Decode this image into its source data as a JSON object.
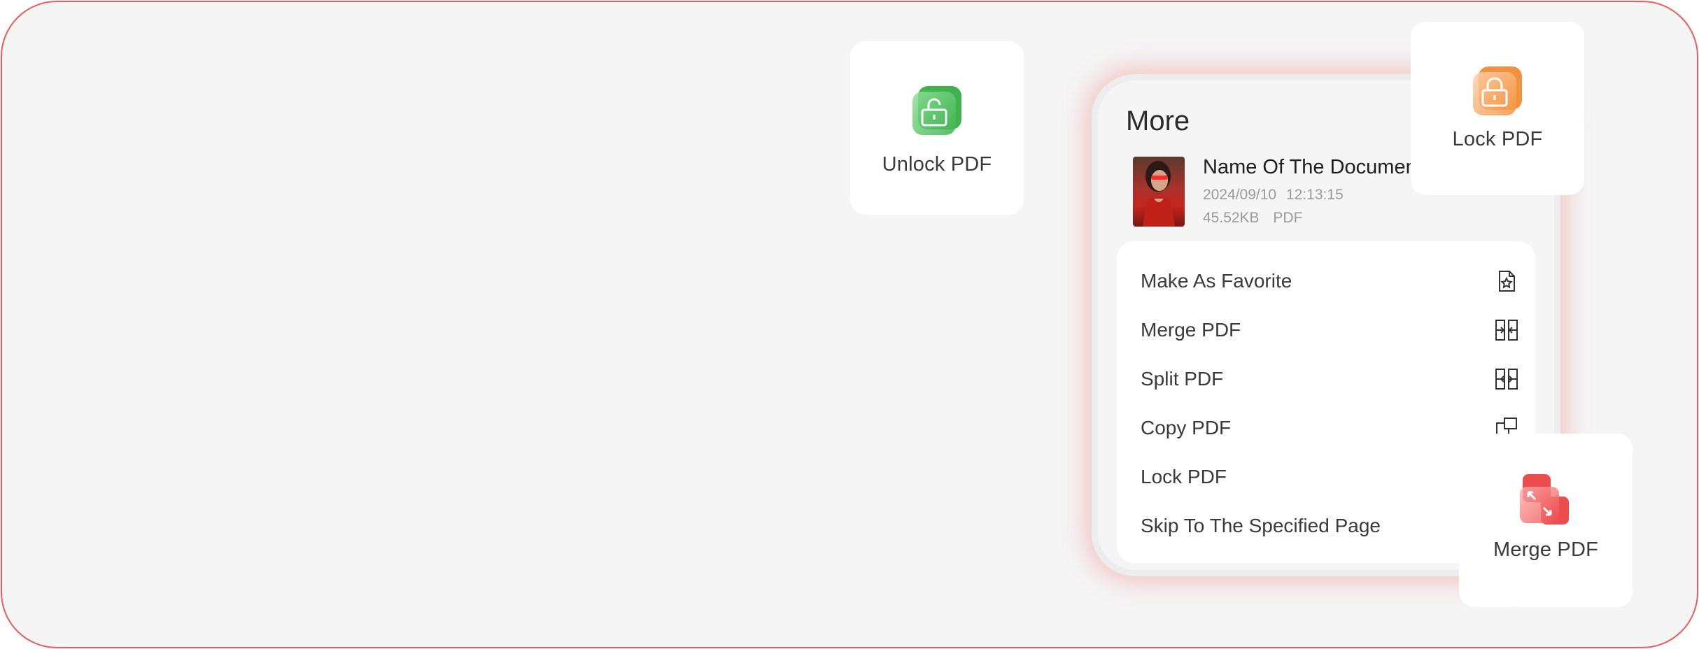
{
  "tiles": {
    "unlock": {
      "label": "Unlock PDF",
      "icon": "unlock-icon",
      "color": "#4cbf5c"
    },
    "lock": {
      "label": "Lock PDF",
      "icon": "lock-icon",
      "color": "#f59a4a"
    },
    "merge": {
      "label": "Merge PDF",
      "icon": "merge-icon",
      "color": "#ef5353"
    }
  },
  "panel": {
    "title": "More",
    "document": {
      "name": "Name Of The Document",
      "date": "2024/09/10",
      "time": "12:13:15",
      "size": "45.52KB",
      "type": "PDF"
    },
    "menu": [
      {
        "label": "Make As Favorite",
        "icon": "favorite-doc-icon"
      },
      {
        "label": "Merge PDF",
        "icon": "merge-icon"
      },
      {
        "label": "Split PDF",
        "icon": "split-icon"
      },
      {
        "label": "Copy PDF",
        "icon": "copy-icon"
      },
      {
        "label": "Lock PDF",
        "icon": "lock-icon"
      },
      {
        "label": "Skip To The Specified Page",
        "icon": "skip-page-icon"
      }
    ]
  },
  "colors": {
    "frame_border": "#ec5c5c",
    "background": "#f5f5f5",
    "panel_glow": "#f05a5a"
  }
}
